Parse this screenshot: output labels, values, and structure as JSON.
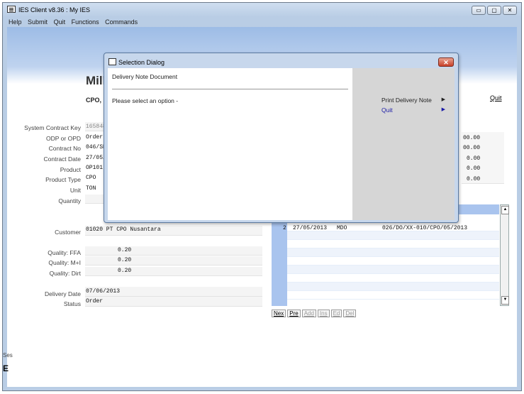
{
  "window": {
    "title": "IES Client v8.36 : My IES",
    "minimize": "▭",
    "maximize": "▢",
    "close": "✕"
  },
  "menu": [
    "Help",
    "Submit",
    "Quit",
    "Functions",
    "Commands"
  ],
  "header": {
    "app_title": "Mill",
    "subtitle": "CPO, K",
    "quit_label": "Quit"
  },
  "form": {
    "system_contract_key": {
      "label": "System Contract Key",
      "value": "165848"
    },
    "odp_or_opd": {
      "label": "ODP or OPD",
      "value": "Order."
    },
    "contract_no": {
      "label": "Contract No",
      "value": "046/SP"
    },
    "contract_date": {
      "label": "Contract Date",
      "value": "27/05/"
    },
    "product": {
      "label": "Product",
      "value": "OP101"
    },
    "product_type": {
      "label": "Product Type",
      "value": "CPO"
    },
    "unit": {
      "label": "Unit",
      "value": "TON"
    },
    "quantity": {
      "label": "Quantity",
      "value": ""
    },
    "customer": {
      "label": "Customer",
      "value": "01020 PT CPO Nusantara"
    },
    "quality_ffa": {
      "label": "Quality: FFA",
      "value": "0.20"
    },
    "quality_mi": {
      "label": "Quality: M+I",
      "value": "0.20"
    },
    "quality_dirt": {
      "label": "Quality: Dirt",
      "value": "0.20"
    },
    "delivery_date": {
      "label": "Delivery Date",
      "value": "07/06/2013"
    },
    "status": {
      "label": "Status",
      "value": "Order"
    }
  },
  "right_values": [
    "00.00",
    "00.00",
    "0.00",
    "0.00",
    "0.00"
  ],
  "grid": {
    "row_num": "2",
    "date": "27/05/2013",
    "type": "MDO",
    "doc": "026/DO/XX-010/CPO/05/2013"
  },
  "nav": [
    "Nex",
    "Pre",
    "Add",
    "Ins",
    "Ed",
    "Del"
  ],
  "session": {
    "label": "Ses",
    "glyph": "E"
  },
  "dialog": {
    "title": "Selection Dialog",
    "close": "✕",
    "doc_label": "Delivery Note Document",
    "prompt": "Please select an option -",
    "options": [
      {
        "label": "Print Delivery Note",
        "arrow": "▶",
        "color": "#222222"
      },
      {
        "label": "Quit",
        "arrow": "▶",
        "color": "#1a1aa6"
      }
    ]
  }
}
